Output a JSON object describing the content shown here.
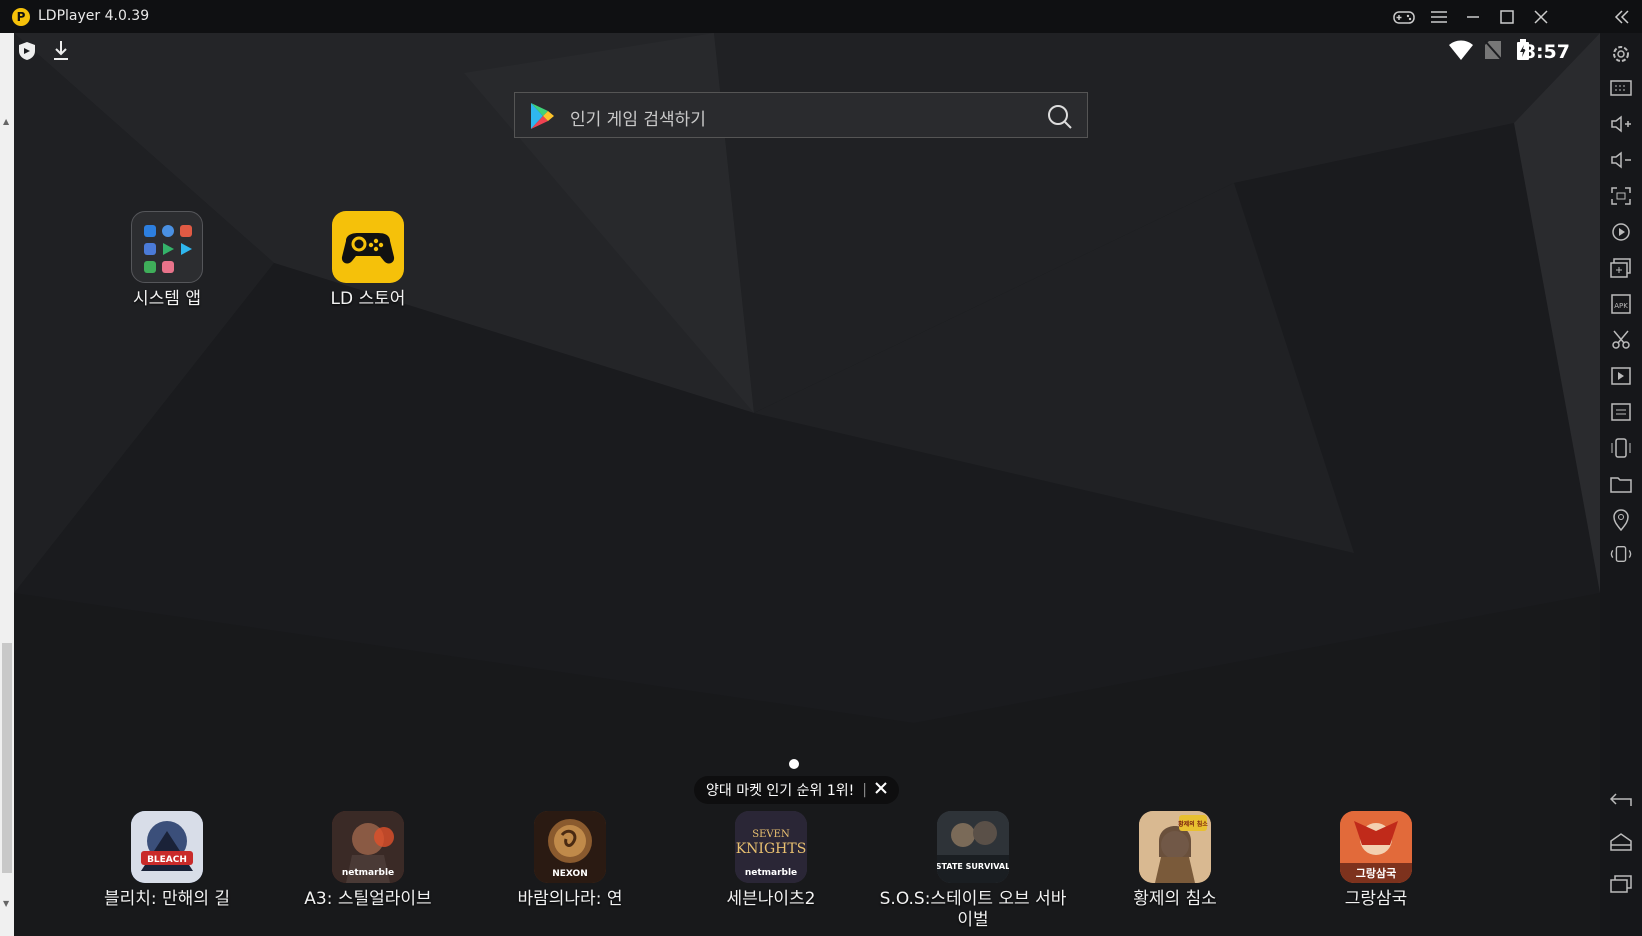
{
  "window": {
    "title": "LDPlayer 4.0.39",
    "logo_letter": "P"
  },
  "status_bar": {
    "time": "8:57"
  },
  "search": {
    "placeholder": "인기 게임 검색하기"
  },
  "home_apps": [
    {
      "label": "시스템 앱",
      "icon": "folder-icon"
    },
    {
      "label": "LD 스토어",
      "icon": "gamepad-store-icon"
    }
  ],
  "dock_apps": [
    {
      "label": "블리치: 만해의 길",
      "icon_text": "BLEACH",
      "color": "#6a86b8"
    },
    {
      "label": "A3: 스틸얼라이브",
      "icon_text": "netmarble",
      "color": "#6b2c24"
    },
    {
      "label": "바람의나라: 연",
      "icon_text": "NEXON",
      "color": "#6e3d1c"
    },
    {
      "label": "세븐나이츠2",
      "icon_text": "netmarble",
      "color": "#3a3446"
    },
    {
      "label": "S.O.S:스테이트 오브 서바이벌",
      "icon_text": "STATE SURVIVAL",
      "color": "#3c4248"
    },
    {
      "label": "황제의 침소",
      "icon_text": "황제의 침소",
      "color": "#b58a5c"
    },
    {
      "label": "그랑삼국",
      "icon_text": "그랑삼국",
      "color": "#c5482e"
    }
  ],
  "toast": {
    "text": "양대 마켓 인기 순위 1위!"
  },
  "colors": {
    "accent": "#f5c10a",
    "background": "#1c1d20"
  }
}
